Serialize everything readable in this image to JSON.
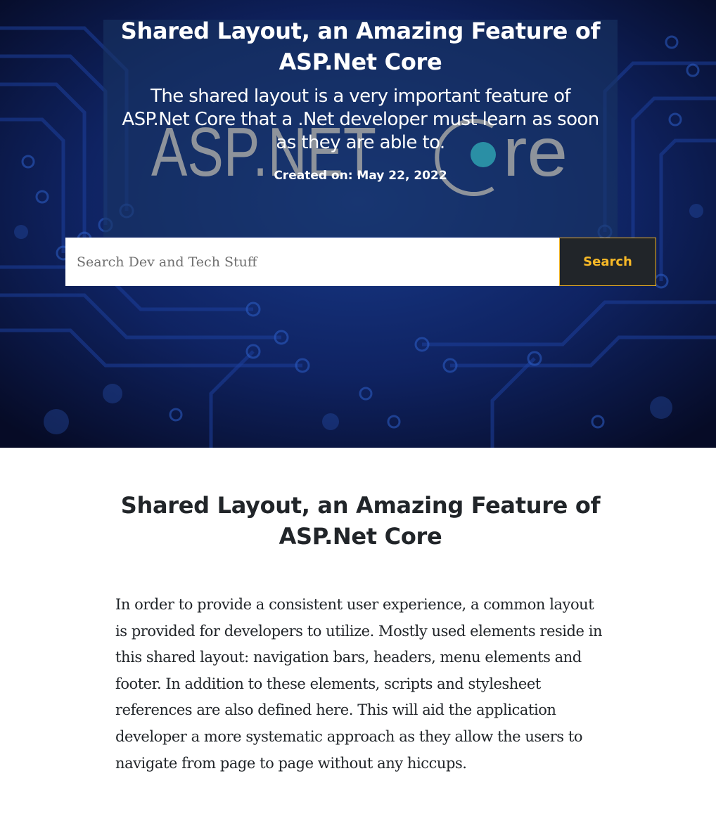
{
  "hero": {
    "title": "Shared Layout, an Amazing Feature of ASP.Net Core",
    "description": "The shared layout is a very important feature of ASP.Net Core that a .Net developer must learn as soon as they are able to.",
    "created_on": "Created on: May 22, 2022",
    "logo_text": "ASP.NET Core",
    "colors": {
      "background": "#0b1440",
      "panel": "#183462",
      "logo_gray": "#8e939b",
      "logo_teal": "#2a8fa5"
    }
  },
  "search": {
    "placeholder": "Search Dev and Tech Stuff",
    "value": "",
    "button_label": "Search",
    "button_text_color": "#f7b927",
    "button_background": "#212529"
  },
  "article": {
    "title": "Shared Layout, an Amazing Feature of ASP.Net Core",
    "body": "In order to provide a consistent user experience, a common layout is provided for developers to utilize. Mostly used elements reside in this shared layout: navigation bars, headers, menu elements and footer. In addition to these elements, scripts and stylesheet references are also defined here. This will aid the application developer a more systematic approach as they allow the users to navigate from page to page without any hiccups."
  }
}
